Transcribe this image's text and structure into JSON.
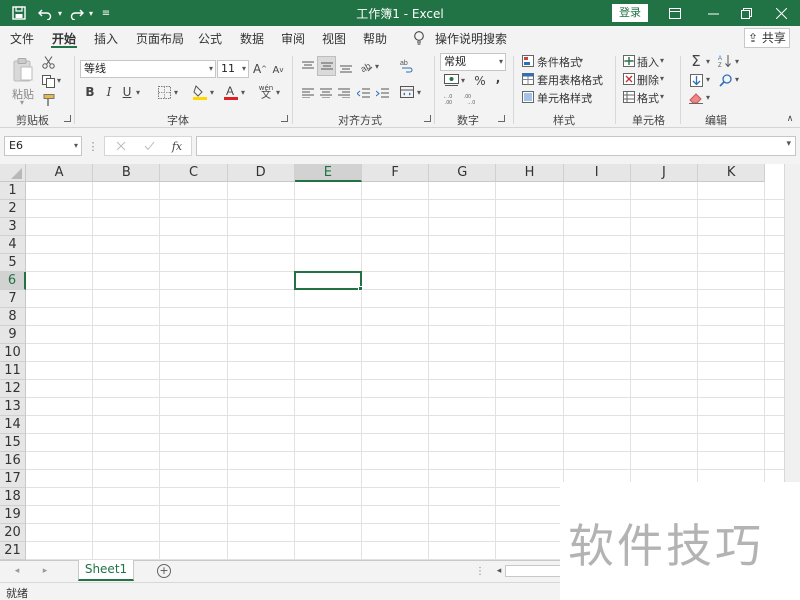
{
  "window": {
    "title": "工作簿1  -  Excel",
    "login_label": "登录",
    "icons": [
      "save-icon",
      "undo-icon",
      "redo-icon",
      "customize-icon",
      "ribbon-display-icon",
      "minimize-icon",
      "restore-icon",
      "close-icon"
    ]
  },
  "menu": {
    "tabs": [
      "文件",
      "开始",
      "插入",
      "页面布局",
      "公式",
      "数据",
      "审阅",
      "视图",
      "帮助"
    ],
    "active_tab": "开始",
    "tell_me": "操作说明搜索",
    "share_label": "共享"
  },
  "ribbon": {
    "clipboard": {
      "paste_label": "粘贴",
      "group_label": "剪贴板"
    },
    "font": {
      "font_name": "等线",
      "font_size": "11",
      "group_label": "字体",
      "grow_label": "A",
      "shrink_label": "A",
      "bold": "B",
      "italic": "I",
      "underline": "U"
    },
    "alignment": {
      "group_label": "对齐方式"
    },
    "number": {
      "format": "常规",
      "group_label": "数字",
      "percent": "%",
      "comma": ","
    },
    "styles": {
      "conditional": "条件格式",
      "table": "套用表格格式",
      "cell_styles": "单元格样式",
      "group_label": "样式"
    },
    "cells": {
      "insert": "插入",
      "delete": "删除",
      "format": "格式",
      "group_label": "单元格"
    },
    "editing": {
      "group_label": "编辑"
    }
  },
  "formula_bar": {
    "name_box": "E6",
    "fx_label": "fx",
    "value": ""
  },
  "sheet": {
    "columns": [
      "A",
      "B",
      "C",
      "D",
      "E",
      "F",
      "G",
      "H",
      "I",
      "J",
      "K"
    ],
    "rows": [
      "1",
      "2",
      "3",
      "4",
      "5",
      "6",
      "7",
      "8",
      "9",
      "10",
      "11",
      "12",
      "13",
      "14",
      "15",
      "16",
      "17",
      "18",
      "19",
      "20",
      "21"
    ],
    "selected_column": "E",
    "selected_row": "6",
    "tabs": [
      "Sheet1"
    ],
    "active_tab": "Sheet1"
  },
  "status": {
    "text": "就绪"
  },
  "colors": {
    "accent": "#217346",
    "watermark": "#b3b3b3"
  },
  "watermark": "软件技巧"
}
